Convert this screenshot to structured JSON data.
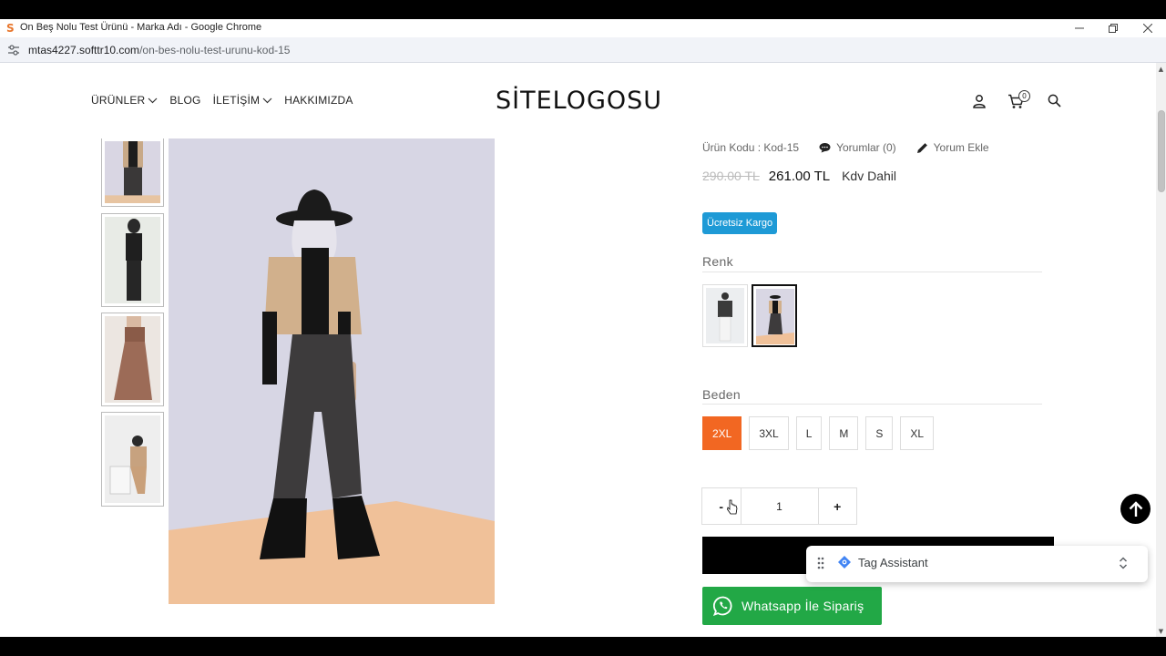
{
  "browser": {
    "window_title": "On Beş Nolu Test Ürünü - Marka Adı - Google Chrome",
    "favicon_letter": "S",
    "url_host": "mtas4227.softtr10.com",
    "url_path": "/on-bes-nolu-test-urunu-kod-15",
    "controls": [
      "minimize-icon",
      "restore-icon",
      "close-icon"
    ]
  },
  "header": {
    "nav": [
      {
        "label": "ÜRÜNLER",
        "has_dropdown": true
      },
      {
        "label": "BLOG",
        "has_dropdown": false
      },
      {
        "label": "İLETİŞİM",
        "has_dropdown": true
      },
      {
        "label": "HAKKIMIZDA",
        "has_dropdown": false
      }
    ],
    "logo": "SİTELOGOSU",
    "cart_count": "0",
    "icons": [
      "user-icon",
      "cart-icon",
      "search-icon"
    ]
  },
  "product": {
    "code": "Ürün Kodu : Kod-15",
    "reviews": "Yorumlar (0)",
    "add_review": "Yorum Ekle",
    "old_price": "290.00 TL",
    "new_price": "261.00 TL",
    "tax_note": "Kdv Dahil",
    "badge": "Ücretsiz Kargo",
    "color_label": "Renk",
    "colors": [
      {
        "name": "white-outfit",
        "selected": false
      },
      {
        "name": "black-outfit",
        "selected": true
      }
    ],
    "size_label": "Beden",
    "sizes": [
      "2XL",
      "3XL",
      "L",
      "M",
      "S",
      "XL"
    ],
    "selected_size": "2XL",
    "qty_minus": "-",
    "qty_value": "1",
    "qty_plus": "+",
    "whatsapp_label": "Whatsapp İle Sipariş",
    "thumbnail_count": 4
  },
  "tag_assistant": {
    "label": "Tag Assistant"
  },
  "colors": {
    "accent_orange": "#f26722",
    "badge_blue": "#1e9ad6",
    "whatsapp_green": "#22a846"
  }
}
